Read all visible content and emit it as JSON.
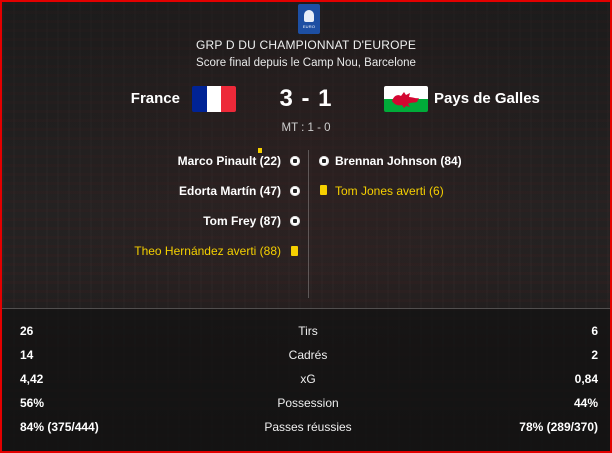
{
  "header": {
    "competition": "GRP D DU CHAMPIONNAT D'EUROPE",
    "venue": "Score final depuis le Camp Nou, Barcelone",
    "logo_icon": "euro-trophy-icon"
  },
  "match": {
    "home_team": "France",
    "away_team": "Pays de Galles",
    "score": "3 - 1",
    "halftime": "MT : 1 - 0",
    "home_flag_colors": [
      "#002395",
      "#ffffff",
      "#ed2939"
    ],
    "away_flag_colors": [
      "#ffffff",
      "#00ab39",
      "#d30731"
    ]
  },
  "events": {
    "home": [
      {
        "text": "Marco Pinault (22)",
        "type": "goal"
      },
      {
        "text": "Edorta Martín (47)",
        "type": "goal"
      },
      {
        "text": "Tom Frey (87)",
        "type": "goal"
      },
      {
        "text": "Theo Hernández averti (88)",
        "type": "yellow-card"
      }
    ],
    "away": [
      {
        "text": "Brennan Johnson (84)",
        "type": "goal"
      },
      {
        "text": "Tom Jones averti (6)",
        "type": "yellow-card"
      }
    ]
  },
  "stats": [
    {
      "label": "Tirs",
      "home": "26",
      "away": "6"
    },
    {
      "label": "Cadrés",
      "home": "14",
      "away": "2"
    },
    {
      "label": "xG",
      "home": "4,42",
      "away": "0,84"
    },
    {
      "label": "Possession",
      "home": "56%",
      "away": "44%"
    },
    {
      "label": "Passes réussies",
      "home": "84% (375/444)",
      "away": "78% (289/370)"
    }
  ],
  "colors": {
    "accent_border": "#e30000",
    "yellow_card": "#f5d000"
  }
}
